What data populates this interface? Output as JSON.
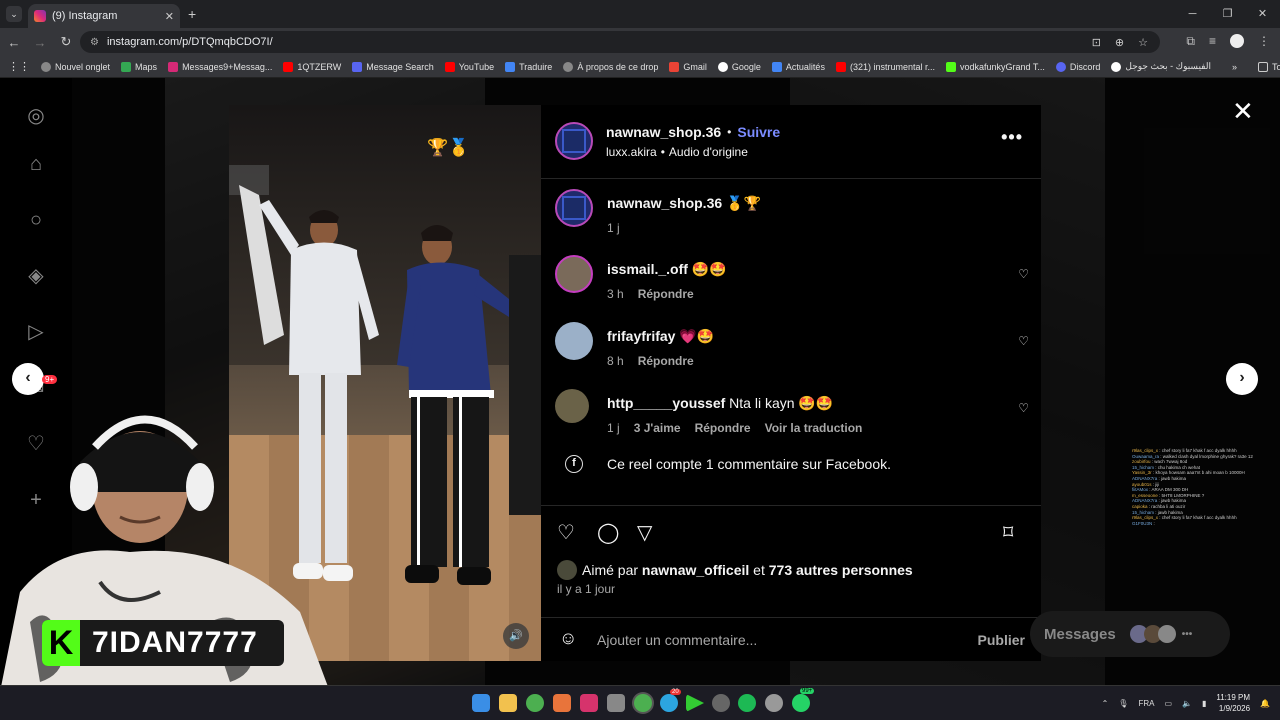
{
  "browser": {
    "tab_title": "(9) Instagram",
    "url": "instagram.com/p/DTQmqbCDO7I/",
    "bookmarks": [
      "Nouvel onglet",
      "Maps",
      "Messages9+Messag...",
      "1QTZERW",
      "Message Search",
      "YouTube",
      "Traduire",
      "À propos de ce drop",
      "Gmail",
      "Google",
      "Actualités",
      "(321) instrumental r...",
      "vodkafunkyGrand T...",
      "Discord",
      "الفيسبوك - بحث جوجل"
    ],
    "all_bookmarks": "Tous les favoris"
  },
  "post": {
    "author": "nawnaw_shop.36",
    "follow_label": "Suivre",
    "audio_user": "luxx.akira",
    "audio_label": "Audio d'origine",
    "video_emojis": "🏆🥇",
    "caption_emojis": "🥇🏆",
    "caption_time": "1 j",
    "comments": [
      {
        "user": "issmail._.off",
        "text": "🤩🤩",
        "time": "3 h",
        "reply": "Répondre",
        "likes": "",
        "translate": ""
      },
      {
        "user": "frifayfrifay",
        "text": "💗🤩",
        "time": "8 h",
        "reply": "Répondre",
        "likes": "",
        "translate": ""
      },
      {
        "user": "http_____youssef",
        "text": "Nta li kayn 🤩🤩",
        "time": "1 j",
        "reply": "Répondre",
        "likes": "3 J'aime",
        "translate": "Voir la traduction"
      }
    ],
    "facebook_note": "Ce reel compte 1 commentaire sur Facebook.",
    "liked_by_prefix": "Aimé par",
    "liked_by_user": "nawnaw_officeil",
    "liked_by_and": "et",
    "liked_by_rest": "773 autres personnes",
    "posted_ago": "il y a 1 jour",
    "comment_placeholder": "Ajouter un commentaire...",
    "publish_label": "Publier"
  },
  "messages_label": "Messages",
  "notification_badge": "9+",
  "overlay": {
    "channel_name": "7IDAN7777",
    "k_logo": "K",
    "chat_lines": [
      [
        "r9las_clips_x",
        "chef story li fa7 khak f acc dyalk hhhh"
      ],
      [
        "Ouwaama_ra",
        "walked clash dyal lmorphine ghyrak? ra3e 12"
      ],
      [
        "zoubirfou",
        "wach 7wwaj 8od"
      ],
      [
        "15_hicham",
        "chu hakima ch wehat"
      ],
      [
        "Yassin_3r",
        "khoya howsam aaa7nt b ahi moan b 10000H"
      ],
      [
        "ADNANX7ra",
        "jawb hakima"
      ],
      [
        "ayoub01s",
        "jiji"
      ],
      [
        "fiitAMox",
        "ARAA DM 300 DH"
      ],
      [
        "m_esseoone",
        "5HT8 LMORPHINE ?"
      ],
      [
        "ADNANX7ra",
        "jawb hakima"
      ],
      [
        "capioka",
        "rachba li ati ouzir"
      ],
      [
        "15_hicham",
        "jawb hakima"
      ],
      [
        "r9las_clips_x",
        "chef story li fa7 khak f acc dyalk hhhh"
      ],
      [
        "G1F0U3N",
        ""
      ]
    ]
  },
  "taskbar": {
    "lang": "FRA",
    "time": "11:19 PM",
    "date": "1/9/2026",
    "badge": "99+",
    "badge2": "20"
  },
  "colors": {
    "follow": "#7b8cff",
    "kick_green": "#53fc18"
  }
}
